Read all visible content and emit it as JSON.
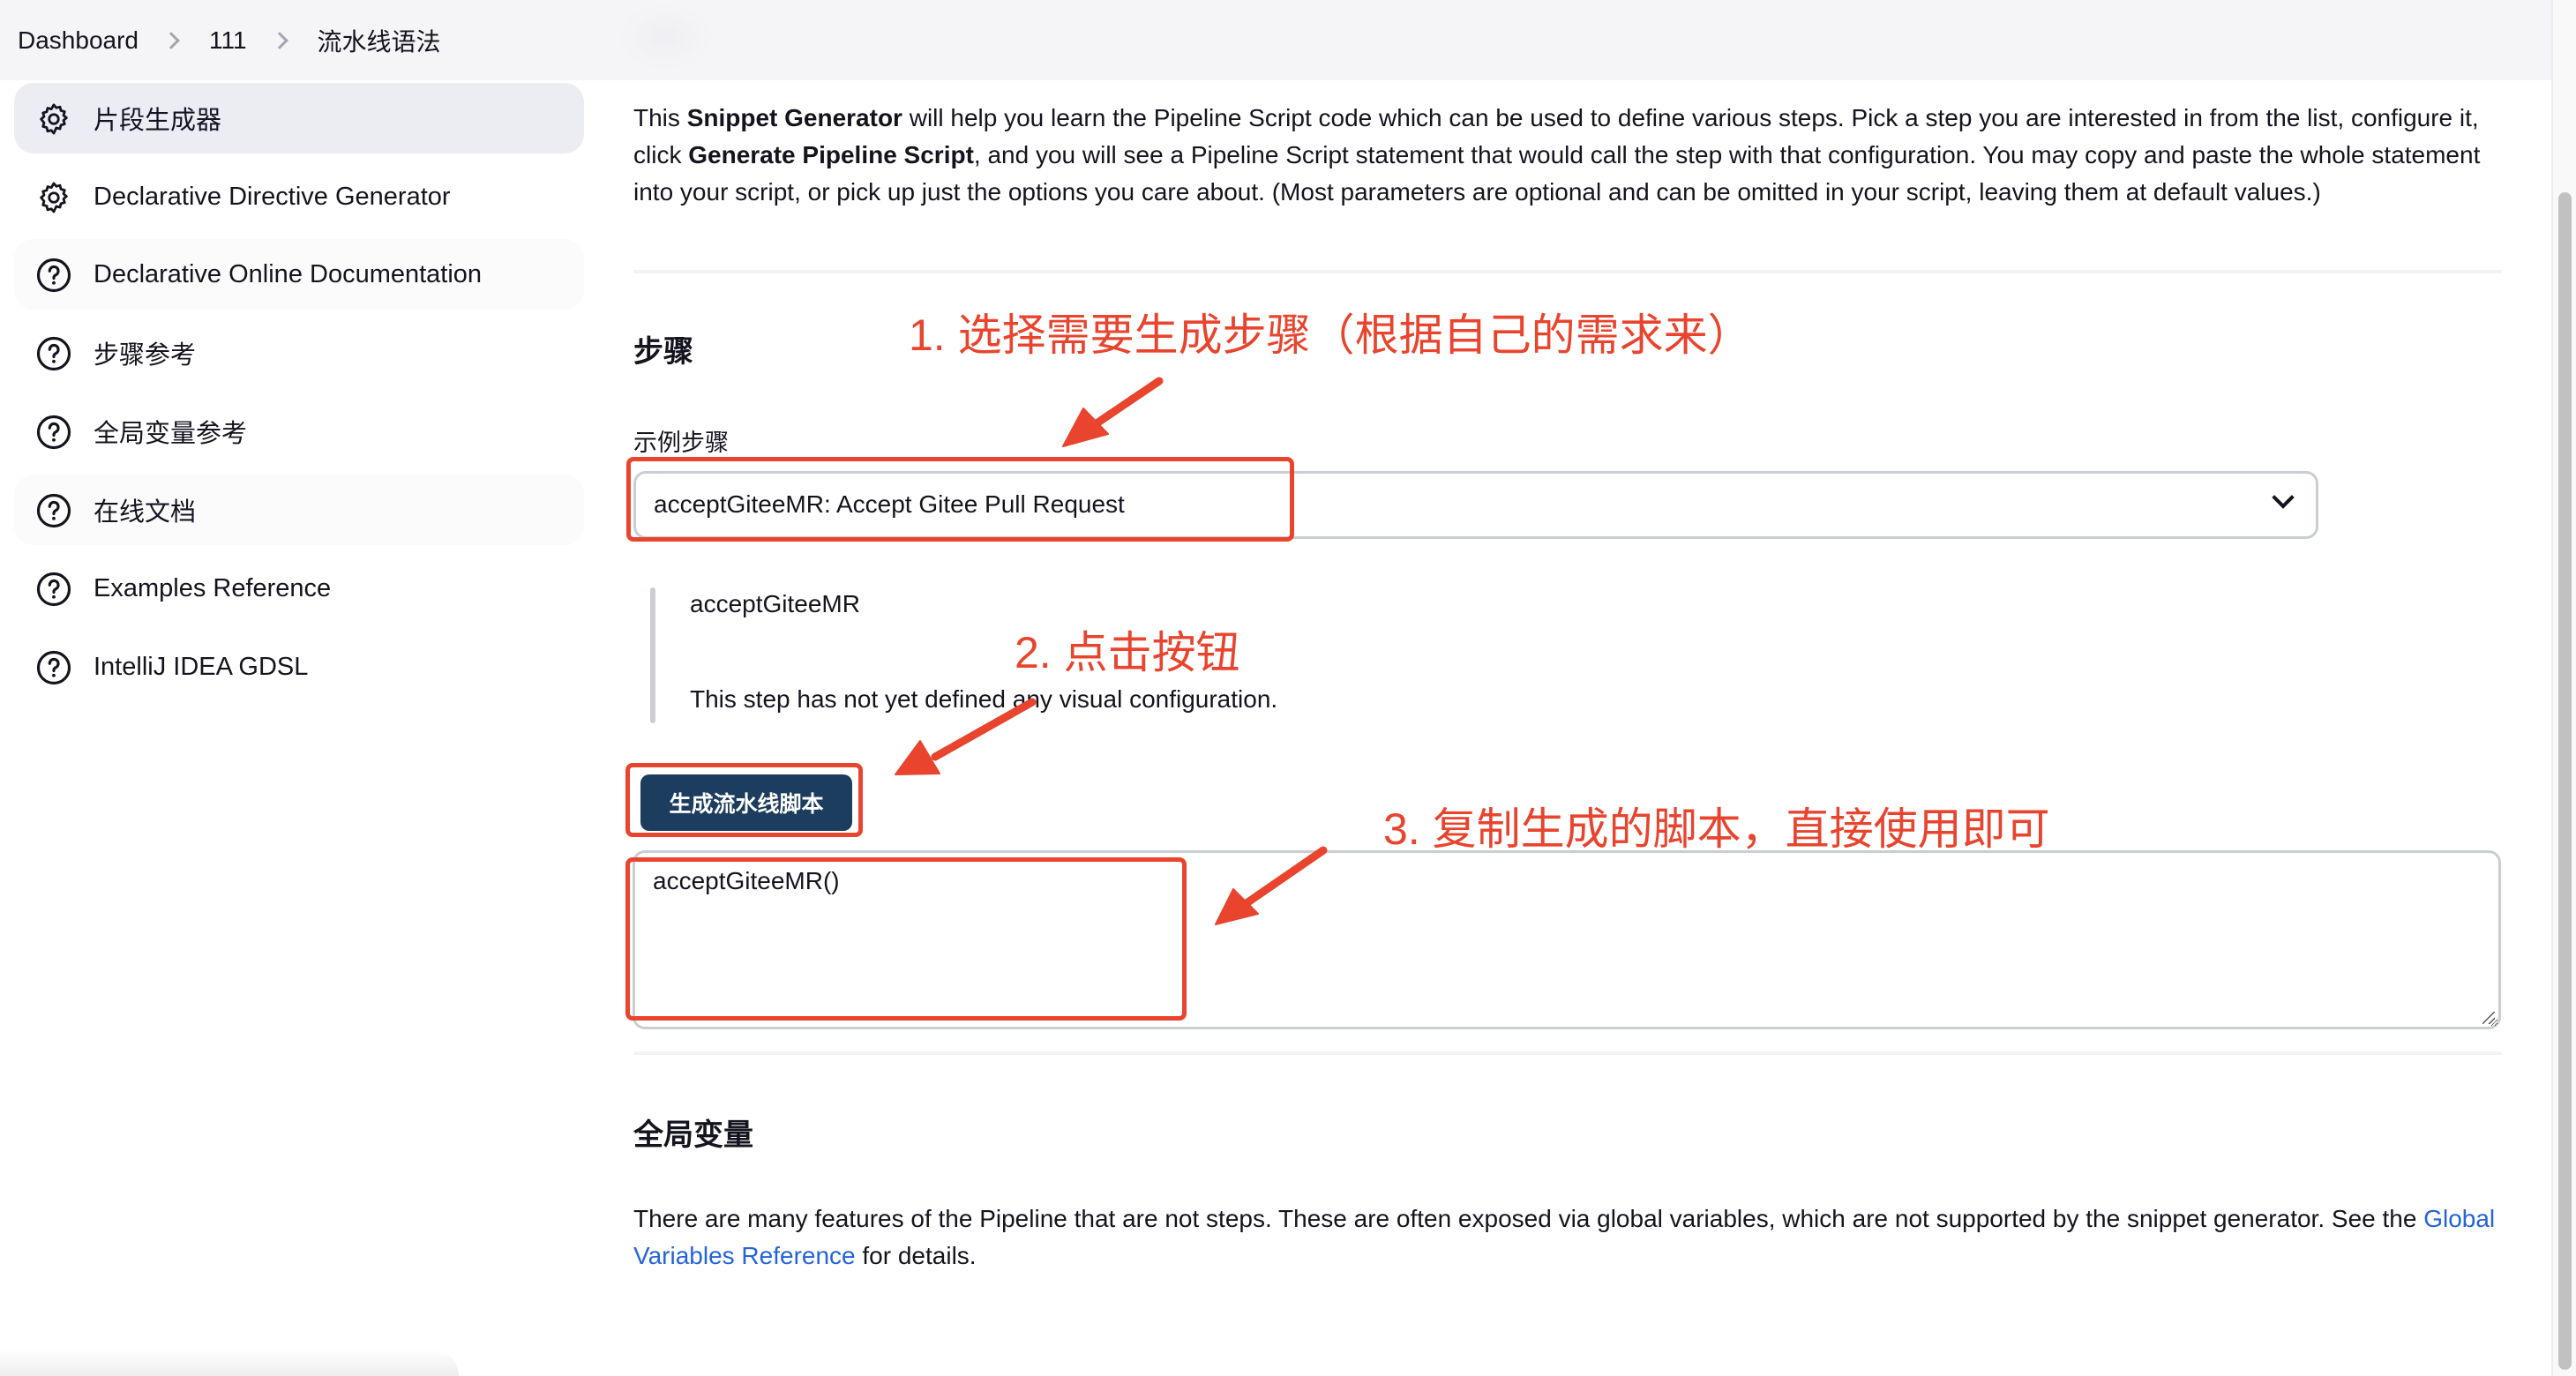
{
  "breadcrumb": [
    {
      "label": "Dashboard"
    },
    {
      "label": "111"
    },
    {
      "label": "流水线语法"
    }
  ],
  "sidebar": {
    "items": [
      {
        "label": "片段生成器",
        "icon": "gear-icon",
        "active": true
      },
      {
        "label": "Declarative Directive Generator",
        "icon": "gear-icon"
      },
      {
        "label": "Declarative Online Documentation",
        "icon": "help-circle-icon"
      },
      {
        "label": "步骤参考",
        "icon": "help-circle-icon"
      },
      {
        "label": "全局变量参考",
        "icon": "help-circle-icon"
      },
      {
        "label": "在线文档",
        "icon": "help-circle-icon"
      },
      {
        "label": "Examples Reference",
        "icon": "help-circle-icon"
      },
      {
        "label": "IntelliJ IDEA GDSL",
        "icon": "help-circle-icon"
      }
    ]
  },
  "main": {
    "intro": {
      "p1": "This ",
      "b1": "Snippet Generator",
      "p2": " will help you learn the Pipeline Script code which can be used to define various steps. Pick a step you are interested in from the list, configure it, click ",
      "b2": "Generate Pipeline Script",
      "p3": ", and you will see a Pipeline Script statement that would call the step with that configuration. You may copy and paste the whole statement into your script, or pick up just the options you care about. (Most parameters are optional and can be omitted in your script, leaving them at default values.)"
    },
    "steps_title": "步骤",
    "sample_step_label": "示例步骤",
    "sample_step_selected": "acceptGiteeMR: Accept Gitee Pull Request",
    "step_name": "acceptGiteeMR",
    "step_note": "This step has not yet defined any visual configuration.",
    "generate_button": "生成流水线脚本",
    "generated_script": "acceptGiteeMR()",
    "global_title": "全局变量",
    "global_text_before": "There are many features of the Pipeline that are not steps. These are often exposed via global variables, which are not supported by the snippet generator. See the ",
    "global_link": "Global Variables Reference",
    "global_text_after": " for details."
  },
  "annotations": {
    "color": "#e8442e",
    "step1": "1. 选择需要生成步骤（根据自己的需求来）",
    "step2": "2. 点击按钮",
    "step3": "3. 复制生成的脚本，直接使用即可"
  },
  "colors": {
    "button_bg": "#1d3d5e",
    "link": "#2563d9",
    "active_sidebar_bg": "#ecedf2"
  }
}
